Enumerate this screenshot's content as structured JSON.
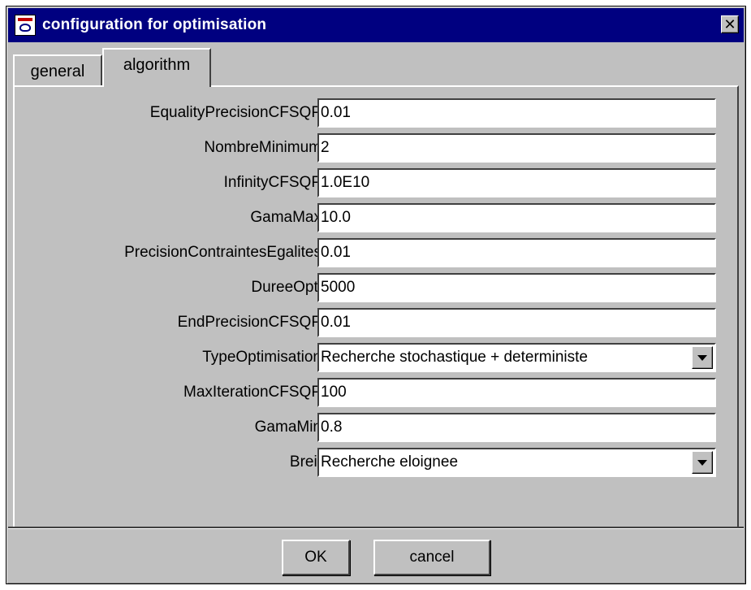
{
  "window": {
    "title": "configuration for optimisation",
    "close_glyph": "✕",
    "icon": "app-icon"
  },
  "tabs": [
    {
      "label": "general",
      "active": false
    },
    {
      "label": "algorithm",
      "active": true
    }
  ],
  "fields": [
    {
      "label": "EqualityPrecisionCFSQP",
      "value": "0.01",
      "type": "text"
    },
    {
      "label": "NombreMinimum",
      "value": "2",
      "type": "text"
    },
    {
      "label": "InfinityCFSQP",
      "value": "1.0E10",
      "type": "text"
    },
    {
      "label": "GamaMax",
      "value": "10.0",
      "type": "text"
    },
    {
      "label": "PrecisionContraintesEgalites",
      "value": "0.01",
      "type": "text"
    },
    {
      "label": "DureeOpti",
      "value": "5000",
      "type": "text"
    },
    {
      "label": "EndPrecisionCFSQP",
      "value": "0.01",
      "type": "text"
    },
    {
      "label": "TypeOptimisation",
      "value": "Recherche stochastique + deterministe",
      "type": "select"
    },
    {
      "label": "MaxIterationCFSQP",
      "value": "100",
      "type": "text"
    },
    {
      "label": "GamaMin",
      "value": "0.8",
      "type": "text"
    },
    {
      "label": "Breit",
      "value": "Recherche eloignee",
      "type": "select"
    }
  ],
  "buttons": {
    "ok_label": "OK",
    "cancel_label": "cancel"
  },
  "colors": {
    "titlebar": "#000080",
    "face": "#c0c0c0",
    "field_bg": "#ffffff"
  }
}
